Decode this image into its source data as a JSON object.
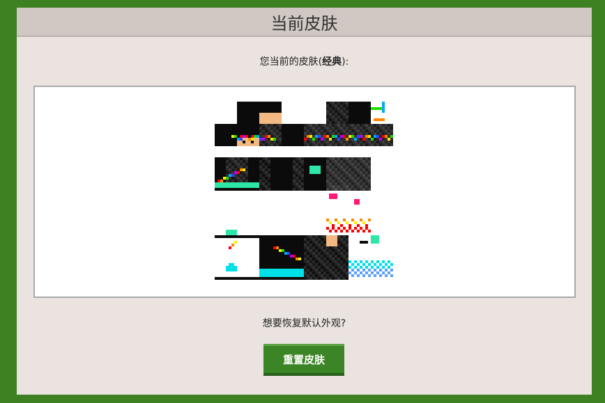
{
  "panel": {
    "title": "当前皮肤"
  },
  "current_skin": {
    "prefix": "您当前的皮肤(",
    "model": "经典",
    "suffix": "):"
  },
  "skin_preview": {
    "description_colors": {
      "black": "#0b0b0b",
      "dark_gray": "#2a2a2a",
      "gray": "#454545",
      "skin_tone": "#f2b983",
      "rainbow": [
        "#ff0000",
        "#ff8800",
        "#ffee00",
        "#22dd00",
        "#00aaff",
        "#3344ff",
        "#bb00ff"
      ],
      "cyan": "#00e0e6",
      "mint": "#2ee6a5",
      "pink": "#ff1a75"
    }
  },
  "reset_prompt": "想要恢复默认外观?",
  "reset_button_label": "重置皮肤",
  "colors": {
    "background": "#3d8122",
    "panel": "#ebe3e0",
    "header": "#d1c7c3",
    "button": "#3b8526"
  }
}
